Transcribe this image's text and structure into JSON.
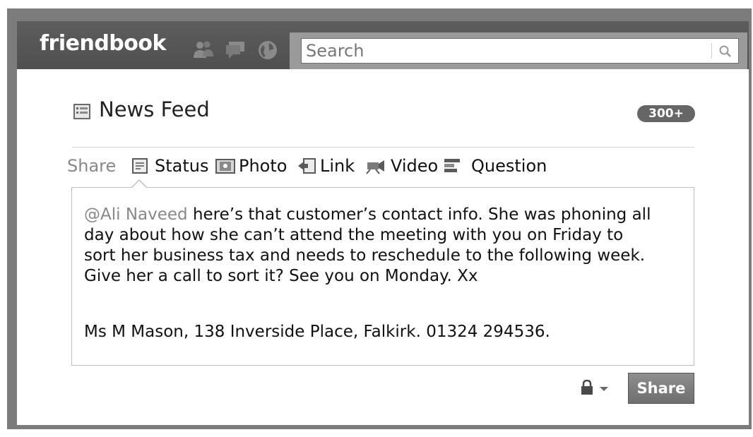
{
  "app": {
    "logo": "friendbook"
  },
  "search": {
    "placeholder": "Search"
  },
  "feed": {
    "title": "News Feed",
    "count_badge": "300+"
  },
  "share_bar": {
    "label": "Share",
    "items": [
      {
        "label": "Status",
        "icon": "status-icon"
      },
      {
        "label": "Photo",
        "icon": "photo-icon"
      },
      {
        "label": "Link",
        "icon": "link-icon"
      },
      {
        "label": "Video",
        "icon": "video-icon"
      },
      {
        "label": "Question",
        "icon": "question-icon"
      }
    ]
  },
  "post": {
    "mention": "@Ali Naveed",
    "line1_rest": " here’s that customer’s contact info. She was phoning all",
    "line2": "day about how she can’t attend the meeting with you on Friday to",
    "line3": "sort her business tax and needs to reschedule to the following week.",
    "line4": "Give her a call to sort it? See you on Monday. Xx",
    "contact": "Ms M Mason, 138 Inverside Place, Falkirk. 01324 294536."
  },
  "actions": {
    "share_button": "Share"
  },
  "colors": {
    "topbar": "#555555",
    "frame": "#7c7c7c",
    "mention": "#888888"
  }
}
